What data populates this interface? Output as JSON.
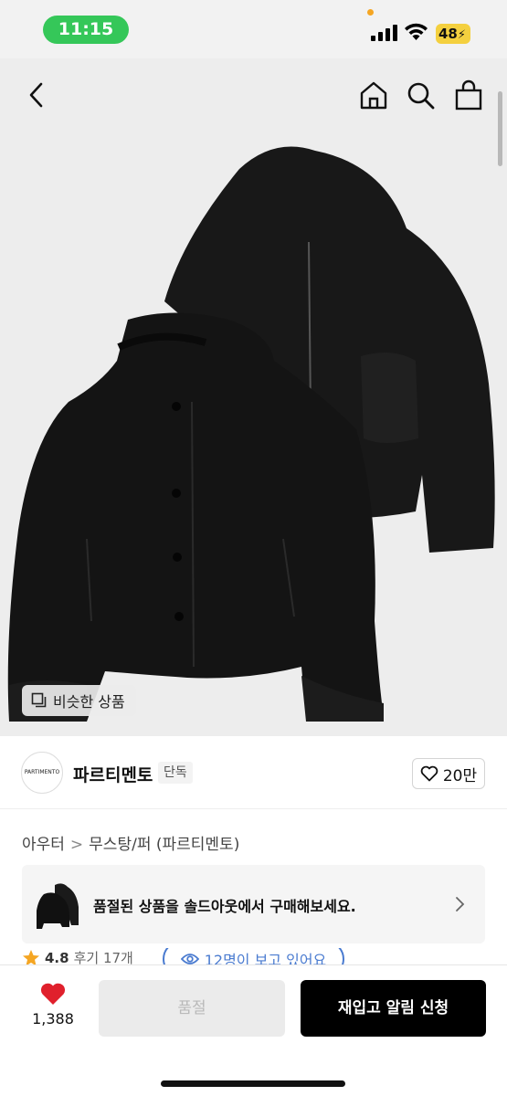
{
  "status_bar": {
    "time": "11:15",
    "battery": "48"
  },
  "hero": {
    "similar_button": "비슷한 상품"
  },
  "brand": {
    "logo_text": "PARTIMENTO",
    "name": "파르티멘토",
    "tag": "단독",
    "like_count": "20만"
  },
  "category": {
    "level1": "아우터",
    "separator": ">",
    "level2": "무스탕/퍼 (파르티멘토)"
  },
  "banner": {
    "text": "품절된 상품을 솔드아웃에서 구매해보세요."
  },
  "rating": {
    "score": "4.8",
    "reviews": "후기 17개",
    "viewers": "12명이 보고 있어요"
  },
  "bottom": {
    "wish_count": "1,388",
    "soldout_label": "품절",
    "restock_label": "재입고 알림 신청"
  },
  "colors": {
    "time_pill": "#35c759",
    "battery": "#f4d03f",
    "heart": "#e0202c",
    "star": "#f5a623",
    "viewers": "#4a7bd0",
    "primary_button": "#000000"
  }
}
